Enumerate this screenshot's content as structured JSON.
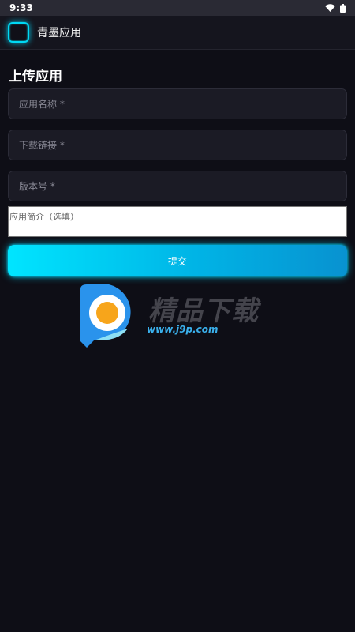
{
  "status_bar": {
    "time": "9:33",
    "wifi_icon": "wifi-icon",
    "battery_icon": "battery-icon"
  },
  "app_bar": {
    "title": "青墨应用",
    "logo_icon": "app-logo-icon"
  },
  "form": {
    "title": "上传应用",
    "app_name_placeholder": "应用名称 *",
    "download_link_placeholder": "下载链接 *",
    "version_placeholder": "版本号 *",
    "description_placeholder": "应用简介（选填）",
    "submit_label": "提交"
  },
  "watermark": {
    "brand": "精品下载",
    "url": "www.j9p.com"
  },
  "colors": {
    "background": "#0e0e16",
    "accent": "#00e5ff",
    "field_background": "#1b1b25"
  }
}
